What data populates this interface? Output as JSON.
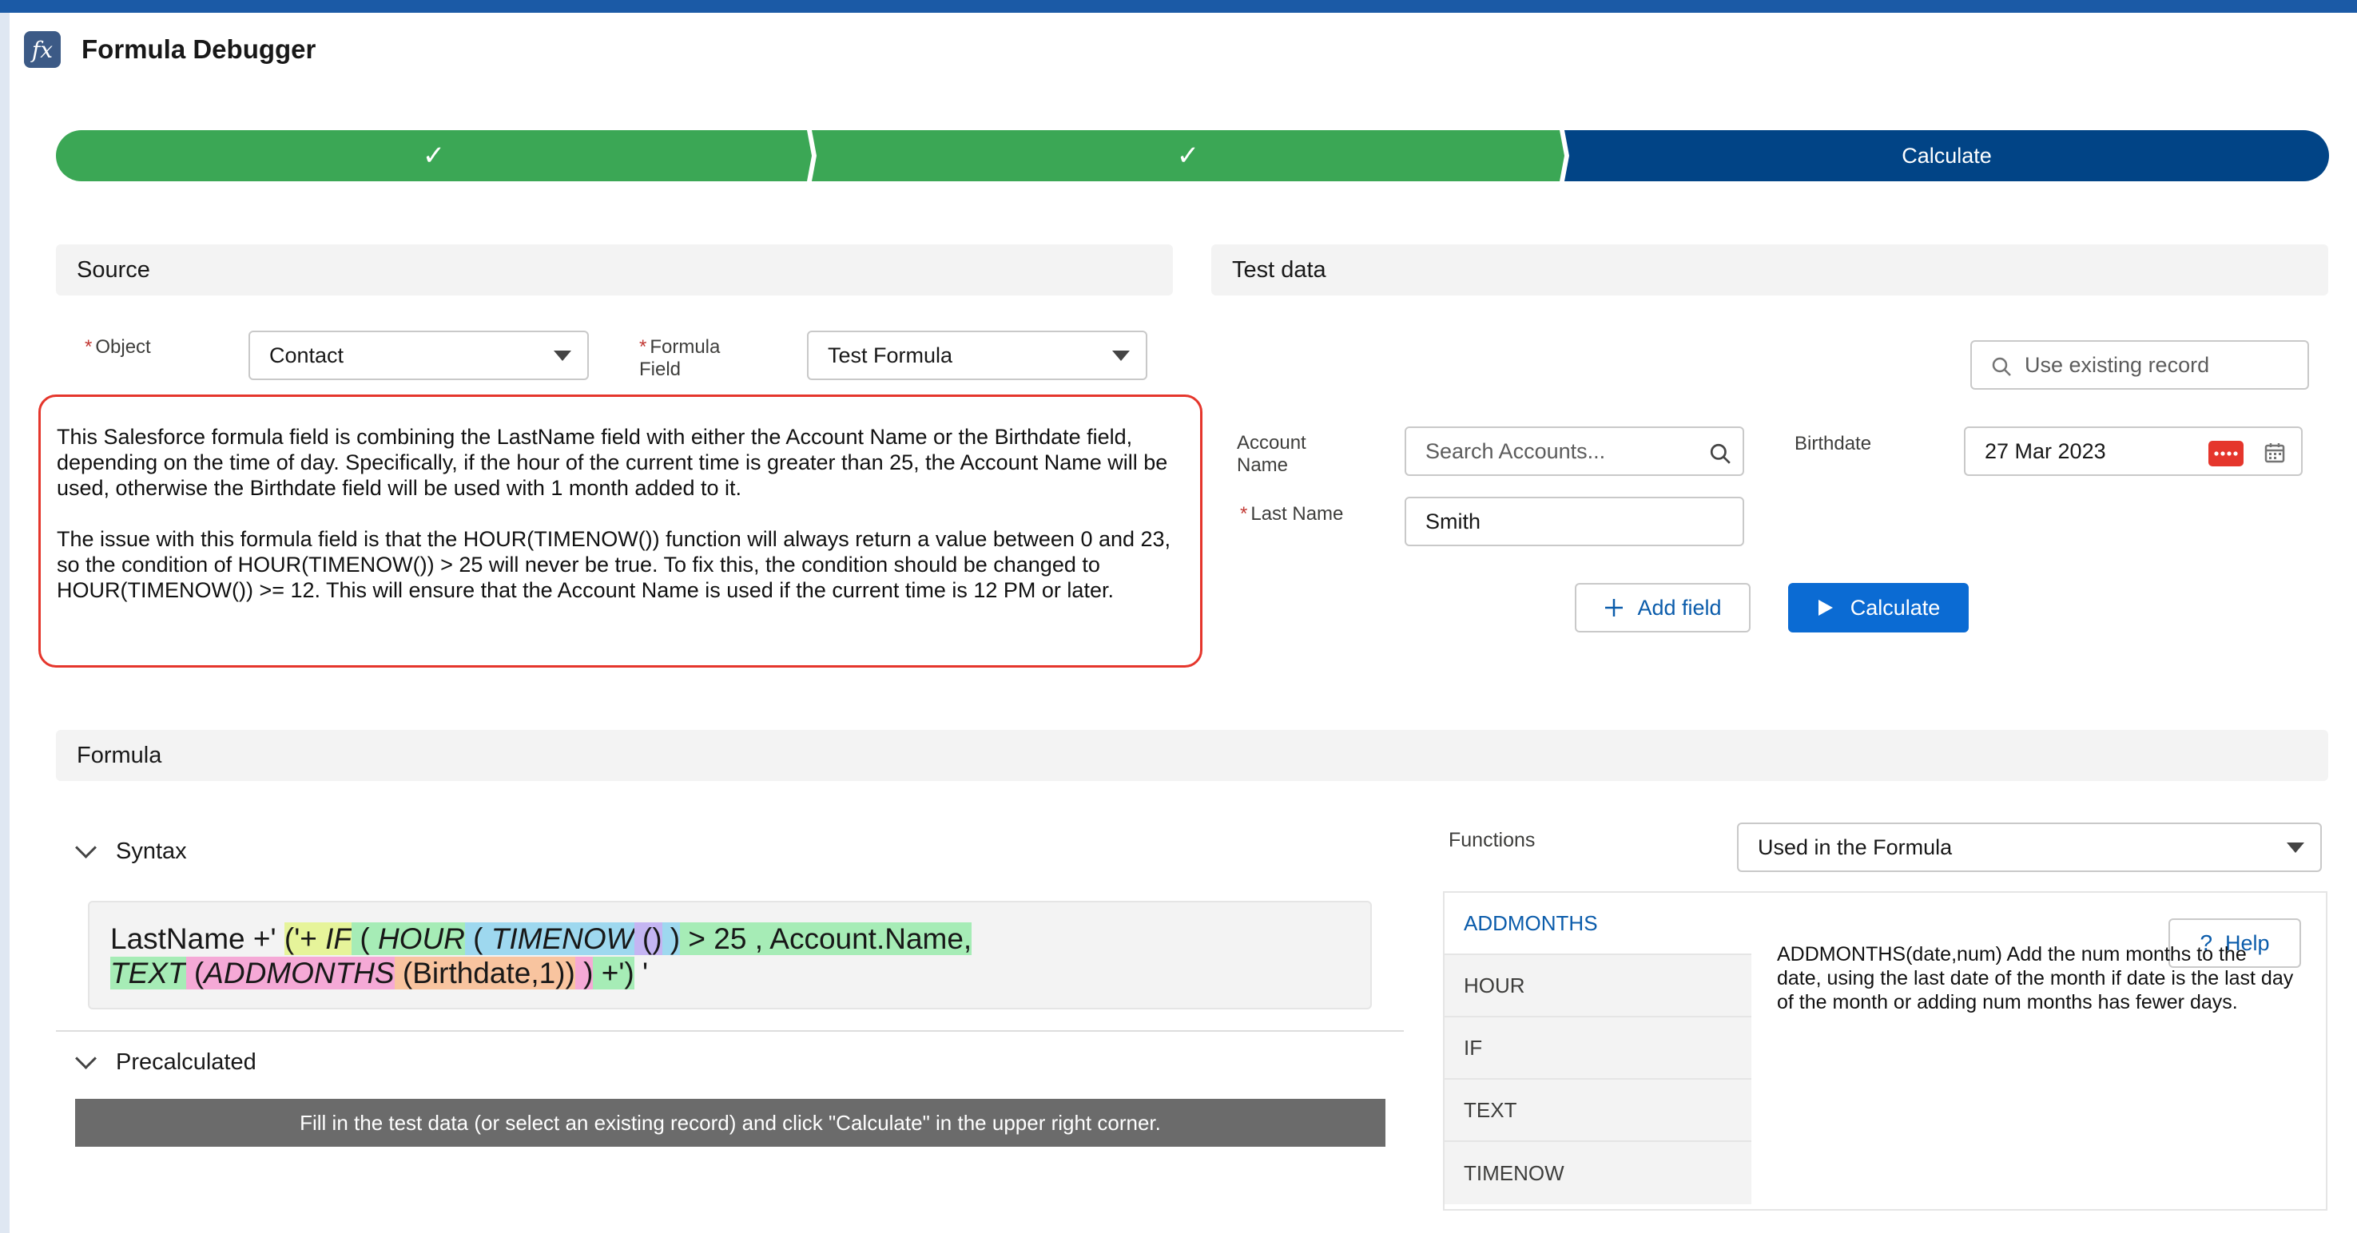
{
  "app": {
    "title": "Formula Debugger",
    "icon_glyph": "fx"
  },
  "path": {
    "steps": [
      {
        "label": "✓",
        "status": "complete"
      },
      {
        "label": "✓",
        "status": "complete"
      },
      {
        "label": "Calculate",
        "status": "current"
      }
    ],
    "colors": {
      "complete": "#3ba755",
      "current": "#014486"
    }
  },
  "source": {
    "heading": "Source",
    "object_label": "Object",
    "object_value": "Contact",
    "formula_field_label_1": "Formula",
    "formula_field_label_2": "Field",
    "formula_field_value": "Test Formula"
  },
  "explanation": {
    "paragraph1": "This Salesforce formula field is combining the LastName field with either the Account Name or the Birthdate field, depending on the time of day. Specifically, if the hour of the current time is greater than 25, the Account Name will be used, otherwise the Birthdate field will be used with 1 month added to it.",
    "paragraph2": "The issue with this formula field is that the HOUR(TIMENOW()) function will always return a value between 0 and 23, so the condition of HOUR(TIMENOW()) > 25 will never be true. To fix this, the condition should be changed to HOUR(TIMENOW()) >= 12. This will ensure that the Account Name is used if the current time is 12 PM or later."
  },
  "test_data": {
    "heading": "Test data",
    "existing_record_placeholder": "Use existing record",
    "account_label_1": "Account",
    "account_label_2": "Name",
    "account_placeholder": "Search Accounts...",
    "birthdate_label": "Birthdate",
    "birthdate_value": "27 Mar 2023",
    "last_name_label": "Last Name",
    "last_name_value": "Smith",
    "add_field_label": "Add field",
    "calculate_label": "Calculate"
  },
  "formula": {
    "heading": "Formula",
    "syntax_label": "Syntax",
    "precalculated_label": "Precalculated",
    "precalculated_message": "Fill in the test data (or select an existing record) and click \"Calculate\" in the upper right corner.",
    "syntax": {
      "t1": "LastName +' ",
      "t2": "('+ ",
      "t3": "IF",
      "t4": " ( ",
      "t5": "HOUR",
      "t6": " ( ",
      "t7": "TIMENOW",
      "t8": " ()",
      "t9": " )",
      "t10": " > 25 , Account.Name,",
      "t11": "TEXT",
      "t12": " (",
      "t13": "ADDMONTHS",
      "t14": " (Birthdate,1))",
      "t15": " )",
      "t16": " +')",
      "t17": " '"
    }
  },
  "functions": {
    "label": "Functions",
    "filter_value": "Used in the Formula",
    "items": [
      "ADDMONTHS",
      "HOUR",
      "IF",
      "TEXT",
      "TIMENOW"
    ],
    "help_label": "Help",
    "description": "ADDMONTHS(date,num) Add the num months to the date, using the last date of the month if date is the last day of the month or adding num months has fewer days."
  }
}
